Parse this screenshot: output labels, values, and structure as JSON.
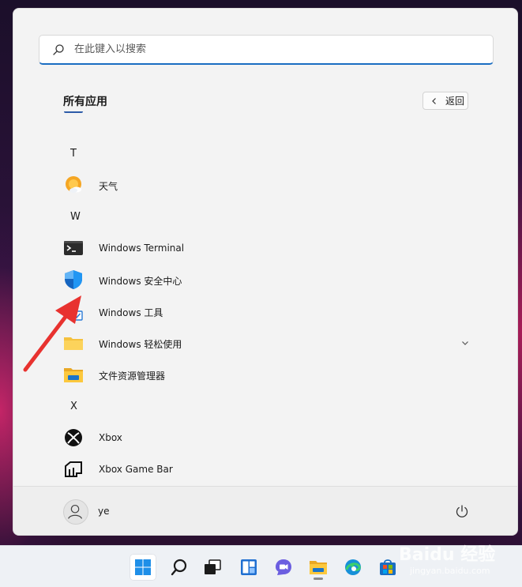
{
  "search": {
    "placeholder": "在此键入以搜索"
  },
  "all_apps": {
    "title": "所有应用",
    "back_label": "返回"
  },
  "app_list": {
    "letter_t": "T",
    "weather": "天气",
    "letter_w": "W",
    "windows_terminal": "Windows Terminal",
    "windows_security": "Windows 安全中心",
    "windows_tools": "Windows 工具",
    "windows_ease": "Windows 轻松使用",
    "file_explorer": "文件资源管理器",
    "letter_x": "X",
    "xbox": "Xbox",
    "xbox_game_bar": "Xbox Game Bar"
  },
  "user": {
    "name": "ye"
  },
  "taskbar": {
    "items": [
      "start-icon",
      "search-icon",
      "task-view-icon",
      "widgets-icon",
      "chat-icon",
      "file-explorer-icon",
      "edge-icon",
      "store-icon"
    ]
  },
  "watermark": {
    "brand": "Baidu 经验",
    "url": "jingyan.baidu.com"
  },
  "colors": {
    "accent": "#1a6dc2",
    "annotation": "#e8322f"
  }
}
